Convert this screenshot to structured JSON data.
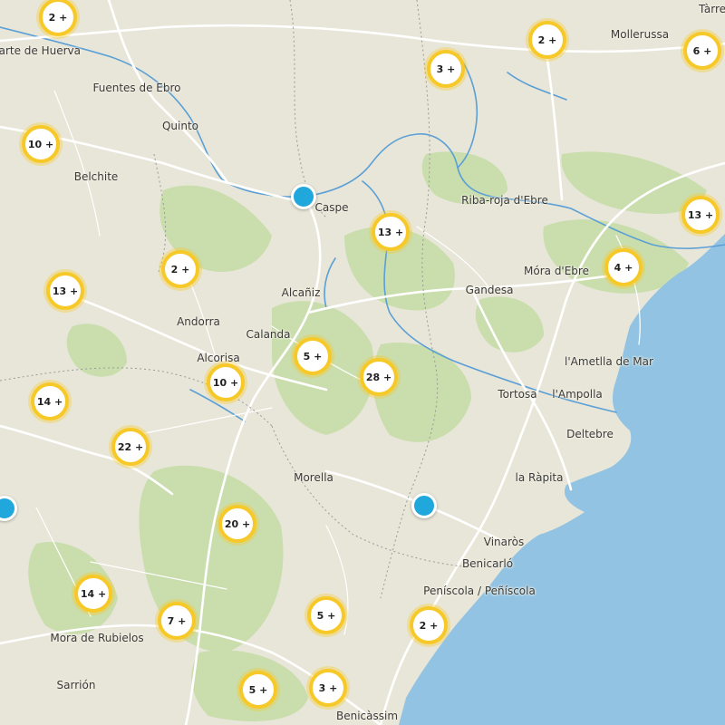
{
  "map": {
    "places": [
      {
        "id": "cuarte-de-huerva",
        "label": "uarte de Huerva"
      },
      {
        "id": "fuentes-de-ebro",
        "label": "Fuentes de Ebro"
      },
      {
        "id": "quinto",
        "label": "Quinto"
      },
      {
        "id": "belchite",
        "label": "Belchite"
      },
      {
        "id": "caspe",
        "label": "Caspe"
      },
      {
        "id": "mollerussa",
        "label": "Mollerussa"
      },
      {
        "id": "tarrega",
        "label": "Tàrre"
      },
      {
        "id": "riba-roja",
        "label": "Riba-roja d'Ebre"
      },
      {
        "id": "mora-debre",
        "label": "Móra d'Ebre"
      },
      {
        "id": "gandesa",
        "label": "Gandesa"
      },
      {
        "id": "alcaniz",
        "label": "Alcañiz"
      },
      {
        "id": "andorra",
        "label": "Andorra"
      },
      {
        "id": "calanda",
        "label": "Calanda"
      },
      {
        "id": "alcorisa",
        "label": "Alcorisa"
      },
      {
        "id": "lametlla",
        "label": "l'Ametlla de Mar"
      },
      {
        "id": "tortosa",
        "label": "Tortosa"
      },
      {
        "id": "lampolla",
        "label": "l'Ampolla"
      },
      {
        "id": "deltebre",
        "label": "Deltebre"
      },
      {
        "id": "la-rapita",
        "label": "la Ràpita"
      },
      {
        "id": "morella",
        "label": "Morella"
      },
      {
        "id": "vinaros",
        "label": "Vinaròs"
      },
      {
        "id": "benicarlo",
        "label": "Benicarló"
      },
      {
        "id": "peniscola",
        "label": "Peníscola / Peñíscola"
      },
      {
        "id": "mora-de-rubielos",
        "label": "Mora de Rubielos"
      },
      {
        "id": "sarrion",
        "label": "Sarrión"
      },
      {
        "id": "benicassim",
        "label": "Benicàssim"
      }
    ],
    "clusters": [
      {
        "id": "zaragoza",
        "label": "2 +"
      },
      {
        "id": "mollerussa",
        "label": "2 +"
      },
      {
        "id": "fraga",
        "label": "3 +"
      },
      {
        "id": "tarrega",
        "label": "6 +"
      },
      {
        "id": "belchite",
        "label": "10 +"
      },
      {
        "id": "lleida-south",
        "label": "13 +"
      },
      {
        "id": "caspe-south",
        "label": "13 +"
      },
      {
        "id": "andorra-north",
        "label": "2 +"
      },
      {
        "id": "mora",
        "label": "4 +"
      },
      {
        "id": "montalban",
        "label": "13 +"
      },
      {
        "id": "calanda",
        "label": "5 +"
      },
      {
        "id": "alcorisa",
        "label": "10 +"
      },
      {
        "id": "matarranya",
        "label": "28 +"
      },
      {
        "id": "aliaga",
        "label": "14 +"
      },
      {
        "id": "cantavieja",
        "label": "22 +"
      },
      {
        "id": "vilafranca",
        "label": "20 +"
      },
      {
        "id": "mora-rubielos-north",
        "label": "14 +"
      },
      {
        "id": "mosqueruela",
        "label": "7 +"
      },
      {
        "id": "albocasser",
        "label": "5 +"
      },
      {
        "id": "peniscola",
        "label": "2 +"
      },
      {
        "id": "lucena",
        "label": "5 +"
      },
      {
        "id": "castellon",
        "label": "3 +"
      }
    ],
    "markers": [
      {
        "id": "caspe-marker"
      },
      {
        "id": "traiguera-marker"
      },
      {
        "id": "west-marker"
      }
    ],
    "colors": {
      "land": "#e8e6d8",
      "forest": "#c4dca6",
      "water": "#92c3e3",
      "river": "#5a9fd6",
      "cluster_ring": "#f7c928",
      "marker": "#20a7dc"
    }
  }
}
